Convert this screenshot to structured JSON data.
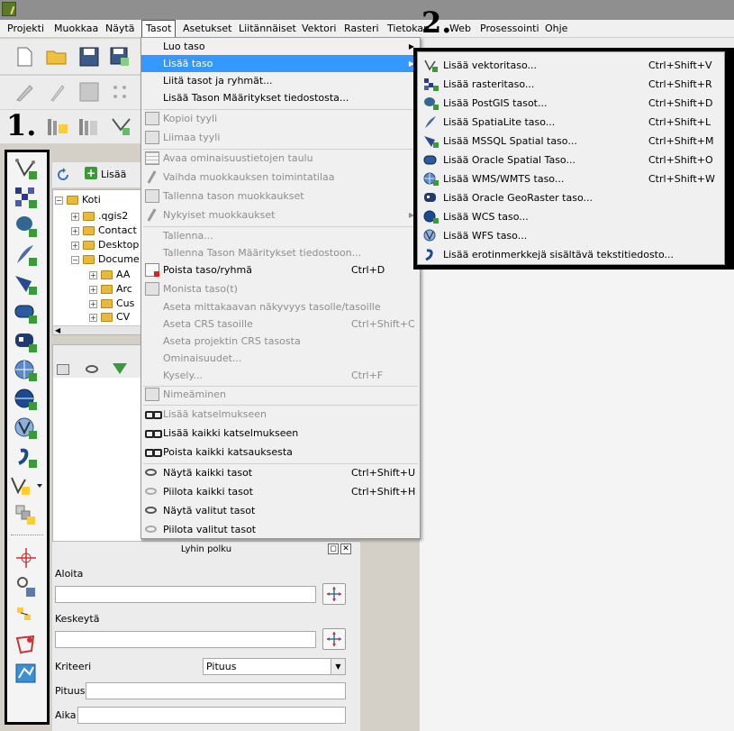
{
  "menubar": {
    "items": [
      "Projekti",
      "Muokkaa",
      "Näytä",
      "Tasot",
      "Asetukset",
      "Liitännäiset",
      "Vektori",
      "Rasteri",
      "Tietokan",
      "Web",
      "Prosessointi",
      "Ohje"
    ]
  },
  "annotations": {
    "one": "1.",
    "two": "2."
  },
  "browser": {
    "add_label": "Lisää",
    "tree": [
      "Koti",
      ".qgis2",
      "Contact",
      "Desktop",
      "Docume",
      "AA",
      "Arc",
      "Cus",
      "CV"
    ]
  },
  "layers_menu": {
    "items": [
      {
        "label": "Luo taso",
        "shortcut": "",
        "submenu": true,
        "disabled": false
      },
      {
        "label": "Lisää taso",
        "shortcut": "",
        "submenu": true,
        "disabled": false
      },
      {
        "label": "Liitä tasot ja ryhmät...",
        "shortcut": "",
        "disabled": false
      },
      {
        "label": "Lisää Tason Määritykset tiedostosta...",
        "shortcut": "",
        "disabled": false
      },
      {
        "label": "Kopioi tyyli",
        "shortcut": "",
        "disabled": true
      },
      {
        "label": "Liimaa tyyli",
        "shortcut": "",
        "disabled": true
      },
      {
        "label": "Avaa ominaisuustietojen taulu",
        "shortcut": "",
        "disabled": true
      },
      {
        "label": "Vaihda muokkauksen toimintatilaa",
        "shortcut": "",
        "disabled": true
      },
      {
        "label": "Tallenna tason muokkaukset",
        "shortcut": "",
        "disabled": true
      },
      {
        "label": "Nykyiset muokkaukset",
        "shortcut": "",
        "submenu": true,
        "disabled": true
      },
      {
        "label": "Tallenna...",
        "shortcut": "",
        "disabled": true
      },
      {
        "label": "Tallenna Tason Määritykset tiedostoon...",
        "shortcut": "",
        "disabled": true
      },
      {
        "label": "Poista taso/ryhmä",
        "shortcut": "Ctrl+D",
        "disabled": false
      },
      {
        "label": "Monista taso(t)",
        "shortcut": "",
        "disabled": true
      },
      {
        "label": "Aseta mittakaavan näkyvyys tasolle/tasoille",
        "shortcut": "",
        "disabled": true
      },
      {
        "label": "Aseta CRS tasoille",
        "shortcut": "Ctrl+Shift+C",
        "disabled": true
      },
      {
        "label": "Aseta projektin CRS tasosta",
        "shortcut": "",
        "disabled": true
      },
      {
        "label": "Ominaisuudet...",
        "shortcut": "",
        "disabled": true
      },
      {
        "label": "Kysely...",
        "shortcut": "Ctrl+F",
        "disabled": true
      },
      {
        "label": "Nimeäminen",
        "shortcut": "",
        "disabled": true
      },
      {
        "label": "Lisää katselmukseen",
        "shortcut": "",
        "disabled": true
      },
      {
        "label": "Lisää kaikki katselmukseen",
        "shortcut": "",
        "disabled": false
      },
      {
        "label": "Poista kaikki katsauksesta",
        "shortcut": "",
        "disabled": false
      },
      {
        "label": "Näytä kaikki tasot",
        "shortcut": "Ctrl+Shift+U",
        "disabled": false
      },
      {
        "label": "Piilota kaikki tasot",
        "shortcut": "Ctrl+Shift+H",
        "disabled": false
      },
      {
        "label": "Näytä valitut tasot",
        "shortcut": "",
        "disabled": false
      },
      {
        "label": "Piilota valitut tasot",
        "shortcut": "",
        "disabled": false
      }
    ]
  },
  "add_layer_submenu": {
    "items": [
      {
        "label": "Lisää vektoritaso...",
        "shortcut": "Ctrl+Shift+V"
      },
      {
        "label": "Lisää rasteritaso...",
        "shortcut": "Ctrl+Shift+R"
      },
      {
        "label": "Lisää PostGIS tasot...",
        "shortcut": "Ctrl+Shift+D"
      },
      {
        "label": "Lisää SpatiaLite taso...",
        "shortcut": "Ctrl+Shift+L"
      },
      {
        "label": "Lisää MSSQL Spatial taso...",
        "shortcut": "Ctrl+Shift+M"
      },
      {
        "label": "Lisää Oracle Spatial Taso...",
        "shortcut": "Ctrl+Shift+O"
      },
      {
        "label": "Lisää WMS/WMTS taso...",
        "shortcut": "Ctrl+Shift+W"
      },
      {
        "label": "Lisää Oracle GeoRaster taso...",
        "shortcut": ""
      },
      {
        "label": "Lisää WCS taso...",
        "shortcut": ""
      },
      {
        "label": "Lisää WFS taso...",
        "shortcut": ""
      },
      {
        "label": "Lisää erotinmerkkejä sisältävä tekstitiedosto...",
        "shortcut": ""
      }
    ]
  },
  "shortest_path": {
    "title": "Lyhin polku",
    "start_label": "Aloita",
    "stop_label": "Keskeytä",
    "criteria_label": "Kriteeri",
    "criteria_value": "Pituus",
    "length_label": "Pituus",
    "time_label": "Aika"
  }
}
